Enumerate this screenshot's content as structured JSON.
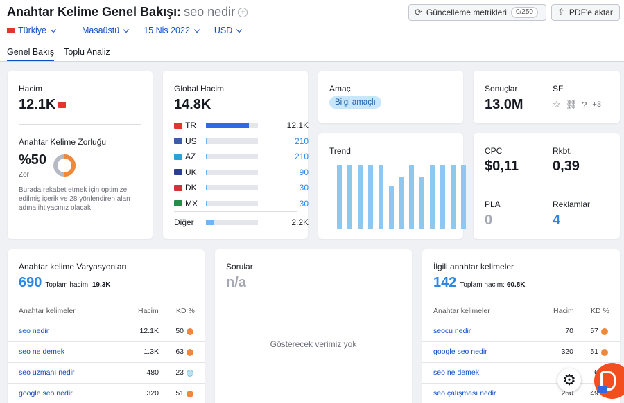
{
  "header": {
    "title": "Anahtar Kelime Genel Bakışı:",
    "keyword": "seo nedir",
    "add_icon": "plus-circle-icon",
    "update_metrics_label": "Güncelleme metrikleri",
    "update_metrics_count": "0/250",
    "export_pdf_label": "PDF'e aktar"
  },
  "filters": {
    "country": "Türkiye",
    "device": "Masaüstü",
    "date": "15 Nis 2022",
    "currency": "USD"
  },
  "tabs": [
    "Genel Bakış",
    "Toplu Analiz"
  ],
  "volume_card": {
    "label": "Hacim",
    "value": "12.1K",
    "kd_label": "Anahtar Kelime Zorluğu",
    "kd_value": "%50",
    "kd_level": "Zor",
    "kd_percent": 50,
    "kd_note": "Burada rekabet etmek için optimize edilmiş içerik ve 28 yönlendiren alan adına ihtiyacınız olacak."
  },
  "global_card": {
    "label": "Global Hacim",
    "value": "14.8K",
    "countries": [
      {
        "code": "TR",
        "value": "12.1K",
        "share": 0.82,
        "color": "#e3342f"
      },
      {
        "code": "US",
        "value": "210",
        "share": 0.02,
        "color": "#3c5ba9"
      },
      {
        "code": "AZ",
        "value": "210",
        "share": 0.02,
        "color": "#2aa3d6"
      },
      {
        "code": "UK",
        "value": "90",
        "share": 0.01,
        "color": "#2a3f8f"
      },
      {
        "code": "DK",
        "value": "30",
        "share": 0.01,
        "color": "#d0343a"
      },
      {
        "code": "MX",
        "value": "30",
        "share": 0.01,
        "color": "#2a8a4a"
      }
    ],
    "other_label": "Diğer",
    "other_value": "2.2K",
    "other_share": 0.14
  },
  "intent_card": {
    "label": "Amaç",
    "badge": "Bilgi amaçlı"
  },
  "trend_card": {
    "label": "Trend",
    "values": [
      1.0,
      1.0,
      1.0,
      1.0,
      1.0,
      0.67,
      0.82,
      1.0,
      0.82,
      1.0,
      1.0,
      1.0,
      1.0
    ]
  },
  "results_card": {
    "results_label": "Sonuçlar",
    "results_value": "13.0M",
    "sf_label": "SF",
    "sf_more": "+3",
    "sf_icons": [
      "star-icon",
      "link-icon",
      "question-icon"
    ]
  },
  "cpc_card": {
    "cpc_label": "CPC",
    "cpc_value": "$0,11",
    "comp_label": "Rkbt.",
    "comp_value": "0,39",
    "pla_label": "PLA",
    "pla_value": "0",
    "ads_label": "Reklamlar",
    "ads_value": "4"
  },
  "variations": {
    "title": "Anahtar kelime Varyasyonları",
    "count": "690",
    "total_label": "Toplam hacim:",
    "total_value": "19.3K",
    "col_keywords": "Anahtar kelimeler",
    "col_volume": "Hacim",
    "col_kd": "KD %",
    "rows": [
      {
        "keyword": "seo nedir",
        "volume": "12.1K",
        "kd": "50"
      },
      {
        "keyword": "seo ne demek",
        "volume": "1.3K",
        "kd": "63"
      },
      {
        "keyword": "seo uzmanı nedir",
        "volume": "480",
        "kd": "23"
      },
      {
        "keyword": "google seo nedir",
        "volume": "320",
        "kd": "51"
      }
    ]
  },
  "questions": {
    "title": "Sorular",
    "value": "n/a",
    "empty_text": "Gösterecek verimiz yok"
  },
  "related": {
    "title": "İlgili anahtar kelimeler",
    "count": "142",
    "total_label": "Toplam hacim:",
    "total_value": "60.8K",
    "col_keywords": "Anahtar kelimeler",
    "col_volume": "Hacim",
    "col_kd": "KD %",
    "rows": [
      {
        "keyword": "seocu nedir",
        "volume": "70",
        "kd": "57"
      },
      {
        "keyword": "google seo nedir",
        "volume": "320",
        "kd": "51"
      },
      {
        "keyword": "seo ne demek",
        "volume": "",
        "kd": "6"
      },
      {
        "keyword": "seo çalışması nedir",
        "volume": "260",
        "kd": "49"
      }
    ]
  },
  "colors": {
    "accent": "#0e4ec7",
    "link_blue": "#2d88e5",
    "kd_orange": "#f0883a",
    "trend_bar": "#8ec7f0",
    "intent_badge": "#c9e7fb"
  }
}
